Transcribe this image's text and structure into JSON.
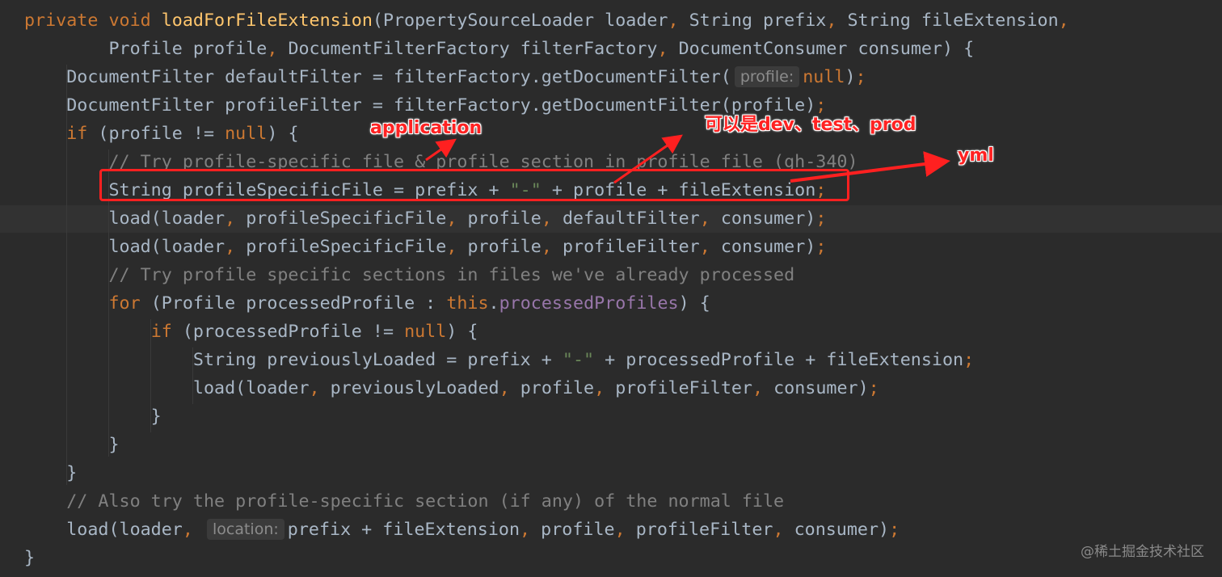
{
  "editor": {
    "language": "java",
    "colors": {
      "background": "#2b2b2b",
      "keyword": "#cc7832",
      "method": "#ffc66d",
      "string": "#6a8759",
      "comment": "#808080",
      "field": "#9876aa",
      "text": "#a9b7c6",
      "annotation": "#ff2222"
    },
    "lines": [
      {
        "tokens": [
          {
            "t": "private void ",
            "c": "kw"
          },
          {
            "t": "loadForFileExtension",
            "c": "fn"
          },
          {
            "t": "(PropertySourceLoader loader"
          },
          {
            "t": ", ",
            "c": "kw"
          },
          {
            "t": "String prefix"
          },
          {
            "t": ", ",
            "c": "kw"
          },
          {
            "t": "String fileExtension"
          },
          {
            "t": ",",
            "c": "kw"
          }
        ]
      },
      {
        "tokens": [
          {
            "t": "        Profile profile"
          },
          {
            "t": ", ",
            "c": "kw"
          },
          {
            "t": "DocumentFilterFactory filterFactory"
          },
          {
            "t": ", ",
            "c": "kw"
          },
          {
            "t": "DocumentConsumer consumer) {"
          }
        ]
      },
      {
        "tokens": [
          {
            "t": "    DocumentFilter defaultFilter = filterFactory.getDocumentFilter("
          },
          {
            "t": "profile:",
            "c": "hint"
          },
          {
            "t": "null",
            "c": "kw"
          },
          {
            "t": ")"
          },
          {
            "t": ";",
            "c": "kw"
          }
        ]
      },
      {
        "tokens": [
          {
            "t": "    DocumentFilter profileFilter = filterFactory.getDocumentFilter(profile)"
          },
          {
            "t": ";",
            "c": "kw"
          }
        ]
      },
      {
        "tokens": [
          {
            "t": "    "
          },
          {
            "t": "if ",
            "c": "kw"
          },
          {
            "t": "(profile != "
          },
          {
            "t": "null",
            "c": "kw"
          },
          {
            "t": ") {"
          }
        ]
      },
      {
        "tokens": [
          {
            "t": "        // Try profile-specific file & profile section in profile file (gh-340)",
            "c": "cm"
          }
        ]
      },
      {
        "tokens": [
          {
            "t": "        String profileSpecificFile = prefix + "
          },
          {
            "t": "\"-\"",
            "c": "str"
          },
          {
            "t": " + profile + fileExtension"
          },
          {
            "t": ";",
            "c": "kw"
          }
        ]
      },
      {
        "tokens": [
          {
            "t": "        load(loader"
          },
          {
            "t": ", ",
            "c": "kw"
          },
          {
            "t": "profileSpecificFile"
          },
          {
            "t": ", ",
            "c": "kw"
          },
          {
            "t": "profile"
          },
          {
            "t": ", ",
            "c": "kw"
          },
          {
            "t": "defaultFilter"
          },
          {
            "t": ", ",
            "c": "kw"
          },
          {
            "t": "consumer)"
          },
          {
            "t": ";",
            "c": "kw"
          }
        ]
      },
      {
        "tokens": [
          {
            "t": "        load(loader"
          },
          {
            "t": ", ",
            "c": "kw"
          },
          {
            "t": "profileSpecificFile"
          },
          {
            "t": ", ",
            "c": "kw"
          },
          {
            "t": "profile"
          },
          {
            "t": ", ",
            "c": "kw"
          },
          {
            "t": "profileFilter"
          },
          {
            "t": ", ",
            "c": "kw"
          },
          {
            "t": "consumer)"
          },
          {
            "t": ";",
            "c": "kw"
          }
        ]
      },
      {
        "tokens": [
          {
            "t": "        // Try profile specific sections in files we've already processed",
            "c": "cm"
          }
        ]
      },
      {
        "tokens": [
          {
            "t": "        "
          },
          {
            "t": "for ",
            "c": "kw"
          },
          {
            "t": "(Profile processedProfile : "
          },
          {
            "t": "this",
            "c": "kw"
          },
          {
            "t": "."
          },
          {
            "t": "processedProfiles",
            "c": "fld"
          },
          {
            "t": ") {"
          }
        ]
      },
      {
        "tokens": [
          {
            "t": "            "
          },
          {
            "t": "if ",
            "c": "kw"
          },
          {
            "t": "(processedProfile != "
          },
          {
            "t": "null",
            "c": "kw"
          },
          {
            "t": ") {"
          }
        ]
      },
      {
        "tokens": [
          {
            "t": "                String previouslyLoaded = prefix + "
          },
          {
            "t": "\"-\"",
            "c": "str"
          },
          {
            "t": " + processedProfile + fileExtension"
          },
          {
            "t": ";",
            "c": "kw"
          }
        ]
      },
      {
        "tokens": [
          {
            "t": "                load(loader"
          },
          {
            "t": ", ",
            "c": "kw"
          },
          {
            "t": "previouslyLoaded"
          },
          {
            "t": ", ",
            "c": "kw"
          },
          {
            "t": "profile"
          },
          {
            "t": ", ",
            "c": "kw"
          },
          {
            "t": "profileFilter"
          },
          {
            "t": ", ",
            "c": "kw"
          },
          {
            "t": "consumer)"
          },
          {
            "t": ";",
            "c": "kw"
          }
        ]
      },
      {
        "tokens": [
          {
            "t": "            }"
          }
        ]
      },
      {
        "tokens": [
          {
            "t": "        }"
          }
        ]
      },
      {
        "tokens": [
          {
            "t": "    }"
          }
        ]
      },
      {
        "tokens": [
          {
            "t": "    // Also try the profile-specific section (if any) of the normal file",
            "c": "cm"
          }
        ]
      },
      {
        "tokens": [
          {
            "t": "    load(loader"
          },
          {
            "t": ", ",
            "c": "kw"
          },
          {
            "t": "location:",
            "c": "hint"
          },
          {
            "t": "prefix + fileExtension"
          },
          {
            "t": ", ",
            "c": "kw"
          },
          {
            "t": "profile"
          },
          {
            "t": ", ",
            "c": "kw"
          },
          {
            "t": "profileFilter"
          },
          {
            "t": ", ",
            "c": "kw"
          },
          {
            "t": "consumer)"
          },
          {
            "t": ";",
            "c": "kw"
          }
        ]
      },
      {
        "tokens": [
          {
            "t": "}"
          }
        ]
      }
    ]
  },
  "annotations": {
    "application": "application",
    "profile_values": "可以是dev、test、prod",
    "yml": "yml"
  },
  "watermark": "@稀土掘金技术社区"
}
